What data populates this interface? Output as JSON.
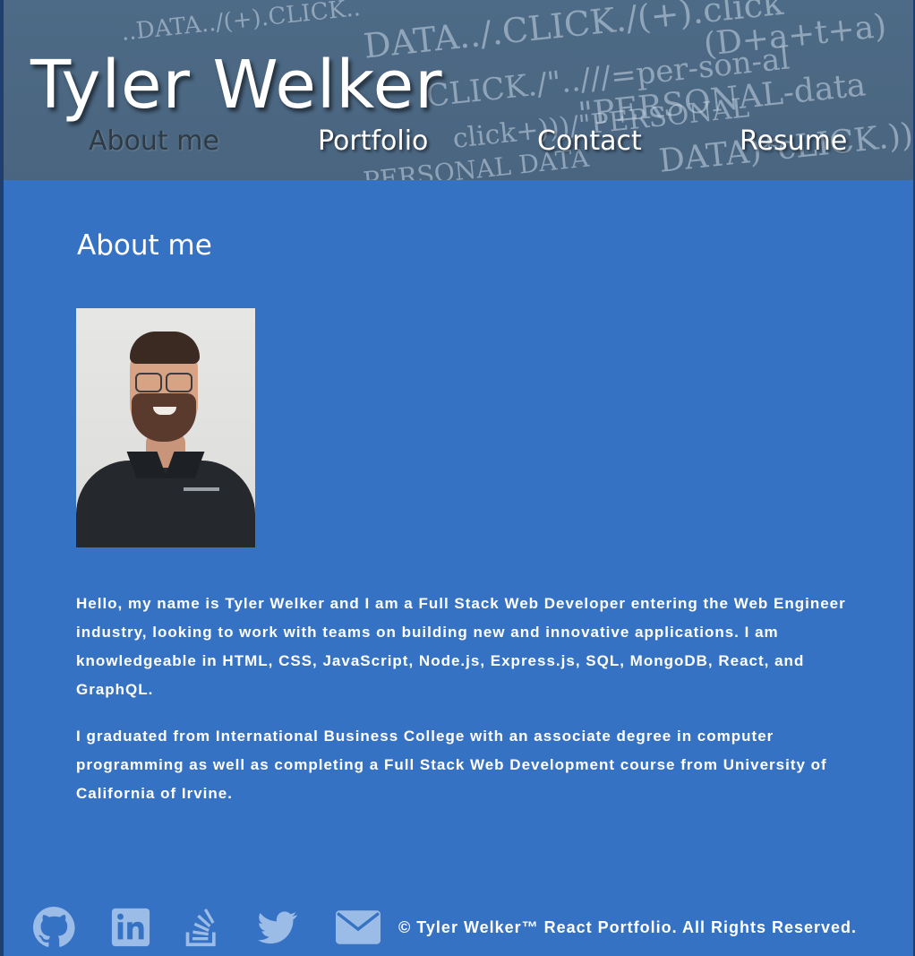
{
  "header": {
    "site_title": "Tyler Welker",
    "background_code_lines": [
      "..DATA../(+).CLICK..",
      "DATA../.CLICK./(+).click",
      "(D+a+t+a)",
      "CLICK./\"..///=per-son-al",
      "\"PERSONAL-data",
      "click+)))/\"PERSONAL",
      "DATA)*cLICK.)))))",
      "PERSONAL DATA"
    ]
  },
  "nav": {
    "items": [
      {
        "label": "About me",
        "active": true
      },
      {
        "label": "Portfolio",
        "active": false
      },
      {
        "label": "Contact",
        "active": false
      },
      {
        "label": "Resume",
        "active": false
      }
    ]
  },
  "main": {
    "section_title": "About me",
    "bio_paragraphs": [
      "Hello, my name is Tyler Welker and I am a Full Stack Web Developer entering the Web Engineer industry, looking to work with teams on building new and innovative applications. I am knowledgeable in HTML, CSS, JavaScript, Node.js, Express.js, SQL, MongoDB, React, and GraphQL.",
      "I graduated from International Business College with an associate degree in computer programming as well as completing a Full Stack Web Development course from University of California of Irvine."
    ]
  },
  "footer": {
    "icons": [
      "github-icon",
      "linkedin-icon",
      "stackoverflow-icon",
      "twitter-icon",
      "email-icon"
    ],
    "copyright": "© Tyler Welker™ React Portfolio. All Rights Reserved."
  },
  "colors": {
    "page_background": "#3672c4",
    "header_background": "#4b6782",
    "icon_color": "#9bbce6",
    "active_nav": "#2e3a44"
  }
}
